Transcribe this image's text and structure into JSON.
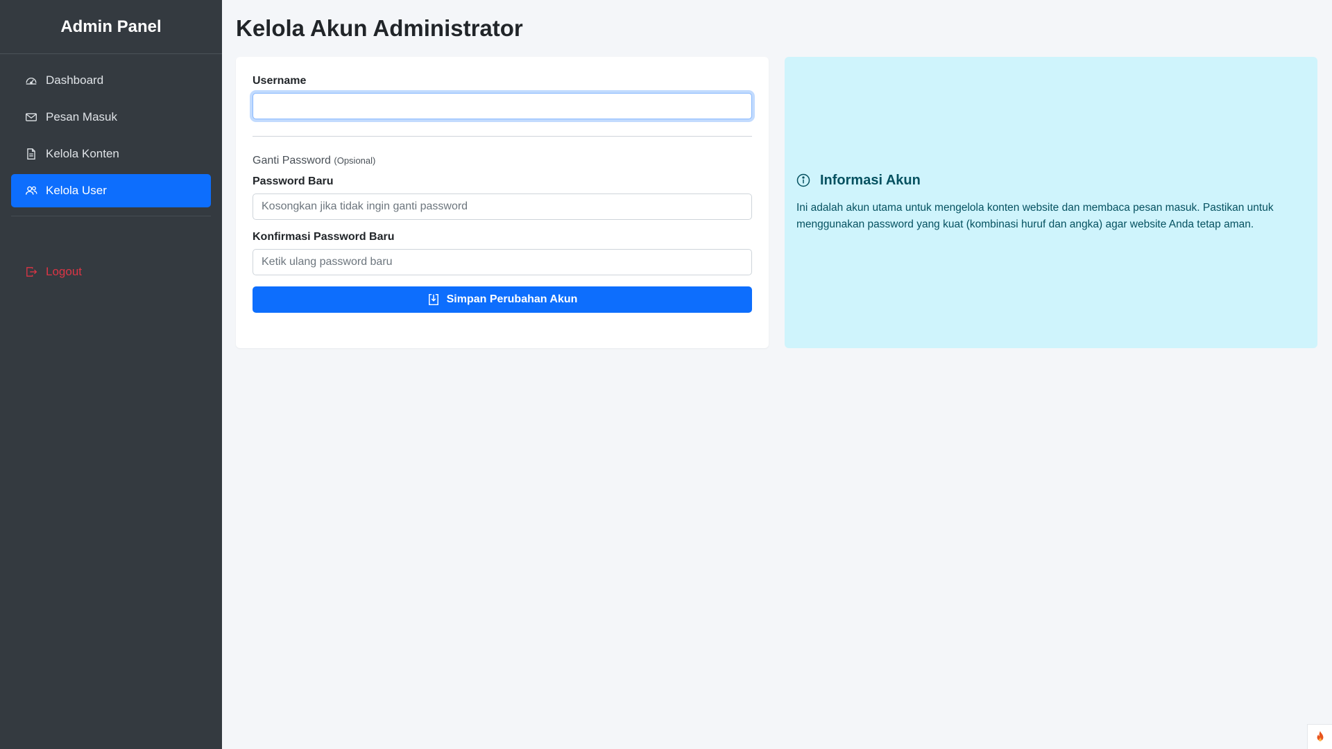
{
  "sidebar": {
    "brand": "Admin Panel",
    "items": [
      {
        "label": "Dashboard",
        "icon": "speedometer-icon"
      },
      {
        "label": "Pesan Masuk",
        "icon": "envelope-icon"
      },
      {
        "label": "Kelola Konten",
        "icon": "document-icon"
      },
      {
        "label": "Kelola User",
        "icon": "users-icon",
        "active": true
      }
    ],
    "logout": {
      "label": "Logout",
      "icon": "logout-icon"
    }
  },
  "main": {
    "title": "Kelola Akun Administrator",
    "form": {
      "username_label": "Username",
      "username_value": "",
      "section_title": "Ganti Password",
      "section_optional": "(Opsional)",
      "new_password_label": "Password Baru",
      "new_password_placeholder": "Kosongkan jika tidak ingin ganti password",
      "confirm_password_label": "Konfirmasi Password Baru",
      "confirm_password_placeholder": "Ketik ulang password baru",
      "submit_label": "Simpan Perubahan Akun"
    },
    "info": {
      "title": "Informasi Akun",
      "text": "Ini adalah akun utama untuk mengelola konten website dan membaca pesan masuk. Pastikan untuk menggunakan password yang kuat (kombinasi huruf dan angka) agar website Anda tetap aman."
    }
  },
  "colors": {
    "sidebar_bg": "#343a40",
    "primary": "#0d6efd",
    "danger": "#dc3545",
    "info_bg": "#cff4fc",
    "info_text": "#055160"
  }
}
